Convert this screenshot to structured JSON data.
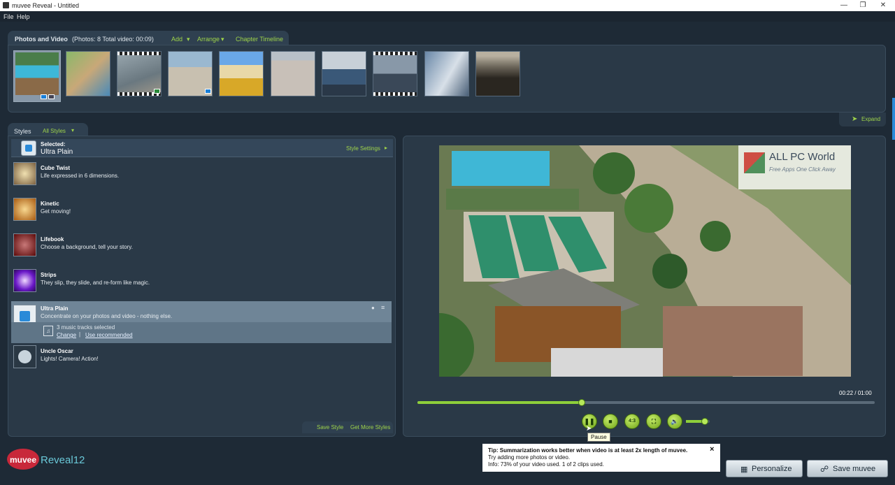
{
  "window": {
    "title": "muvee Reveal - Untitled"
  },
  "menu": {
    "file": "File",
    "help": "Help"
  },
  "photos": {
    "tab_title": "Photos and Video",
    "stats": "(Photos: 8   Total video: 00:09)",
    "add": "Add",
    "arrange": "Arrange",
    "chapter_timeline": "Chapter Timeline",
    "expand": "Expand"
  },
  "styles": {
    "tab_title": "Styles",
    "filter": "All Styles",
    "selected_label": "Selected:",
    "selected_name": "Ultra Plain",
    "style_settings": "Style Settings",
    "items": [
      {
        "name": "Cube Twist",
        "desc": "Life expressed in 6 dimensions.",
        "color": "#c9a870"
      },
      {
        "name": "Kinetic",
        "desc": "Get moving!",
        "color": "#d08a2a"
      },
      {
        "name": "Lifebook",
        "desc": "Choose a background, tell your story.",
        "color": "#8a1818"
      },
      {
        "name": "Strips",
        "desc": "They slip, they slide, and re-form like magic.",
        "color": "#7a2ad8"
      },
      {
        "name": "Ultra Plain",
        "desc": "Concentrate on your photos and video - nothing else.",
        "color": "#2a8ad8"
      },
      {
        "name": "Uncle Oscar",
        "desc": "Lights! Camera! Action!",
        "color": "#3a4a58"
      }
    ],
    "music_tracks": "3 music tracks selected",
    "change": "Change",
    "use_recommended": "Use recommended",
    "save_style": "Save Style",
    "get_more_styles": "Get More Styles"
  },
  "preview": {
    "time": "00:22 / 01:00",
    "progress": 0.36,
    "volume": 0.8,
    "aspect_label": "4:3",
    "tooltip": "Pause",
    "watermark_title": "ALL PC World",
    "watermark_sub": "Free Apps One Click Away"
  },
  "tip": {
    "line1": "Tip: Summarization works better when video is at least 2x length of muvee.",
    "line2": "Try adding more photos or video.",
    "line3": "Info: 73% of your video used. 1 of 2 clips used.",
    "close": "×"
  },
  "logo": {
    "muvee": "muvee",
    "reveal": "Reveal12"
  },
  "buttons": {
    "personalize": "Personalize",
    "save_muvee": "Save muvee"
  },
  "colors": {
    "accent": "#9fd44a",
    "bg": "#1e2a36",
    "panel": "#2a3947"
  }
}
